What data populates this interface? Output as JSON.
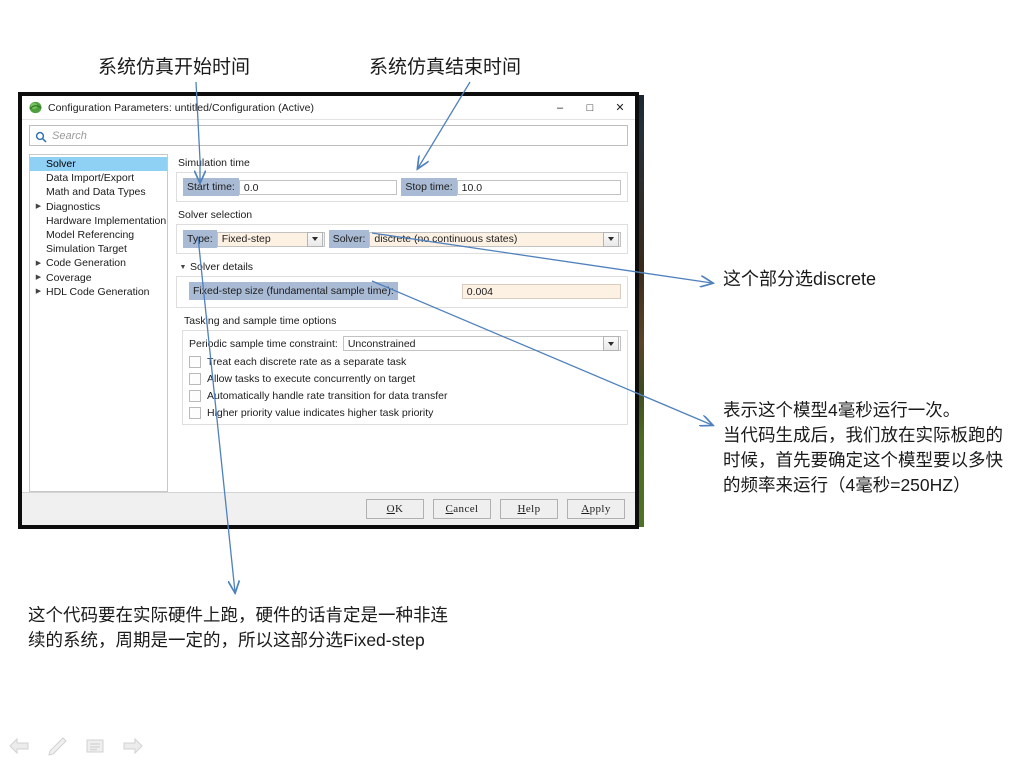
{
  "annotations": {
    "start_time": "系统仿真开始时间",
    "stop_time": "系统仿真结束时间",
    "discrete": "这个部分选discrete",
    "millisecond": "表示这个模型4毫秒运行一次。\n当代码生成后，我们放在实际板跑的时候，首先要确定这个模型要以多快的频率来运行（4毫秒=250HZ）",
    "fixed_step": "这个代码要在实际硬件上跑，硬件的话肯定是一种非连续的系统，周期是一定的，所以这部分选Fixed-step",
    "arrow_color": "#4f81bd"
  },
  "window": {
    "title": "Configuration Parameters: untitled/Configuration (Active)",
    "app_icon": "matlab-simulink-icon",
    "minimize": "–",
    "maximize": "□",
    "close": "✕"
  },
  "search": {
    "icon": "search-icon",
    "placeholder": "Search",
    "value": ""
  },
  "tree": {
    "items": [
      {
        "label": "Solver",
        "twisty": "",
        "selected": true
      },
      {
        "label": "Data Import/Export",
        "twisty": "",
        "selected": false
      },
      {
        "label": "Math and Data Types",
        "twisty": "",
        "selected": false
      },
      {
        "label": "Diagnostics",
        "twisty": "▶",
        "selected": false
      },
      {
        "label": "Hardware Implementation",
        "twisty": "",
        "selected": false
      },
      {
        "label": "Model Referencing",
        "twisty": "",
        "selected": false
      },
      {
        "label": "Simulation Target",
        "twisty": "",
        "selected": false
      },
      {
        "label": "Code Generation",
        "twisty": "▶",
        "selected": false
      },
      {
        "label": "Coverage",
        "twisty": "▶",
        "selected": false
      },
      {
        "label": "HDL Code Generation",
        "twisty": "▶",
        "selected": false
      }
    ]
  },
  "simulation_time": {
    "group_title": "Simulation time",
    "start_label": "Start time:",
    "start_value": "0.0",
    "stop_label": "Stop time:",
    "stop_value": "10.0"
  },
  "solver_selection": {
    "group_title": "Solver selection",
    "type_label": "Type:",
    "type_value": "Fixed-step",
    "solver_label": "Solver:",
    "solver_value": "discrete (no continuous states)"
  },
  "solver_details": {
    "section_title": "Solver details",
    "twisty": "▼",
    "step_label": "Fixed-step size (fundamental sample time):",
    "step_value": "0.004",
    "tasking_title": "Tasking and sample time options",
    "constraint_label": "Periodic sample time constraint:",
    "constraint_value": "Unconstrained",
    "checkboxes": [
      {
        "label": "Treat each discrete rate as a separate task",
        "checked": false
      },
      {
        "label": "Allow tasks to execute concurrently on target",
        "checked": false
      },
      {
        "label": "Automatically handle rate transition for data transfer",
        "checked": false
      },
      {
        "label": "Higher priority value indicates higher task priority",
        "checked": false
      }
    ]
  },
  "footer": {
    "ok": "OK",
    "cancel": "Cancel",
    "help": "Help",
    "apply": "Apply"
  },
  "navbar": {
    "items": [
      {
        "icon": "arrow-left-icon"
      },
      {
        "icon": "pencil-icon"
      },
      {
        "icon": "document-icon"
      },
      {
        "icon": "arrow-right-icon"
      }
    ]
  }
}
